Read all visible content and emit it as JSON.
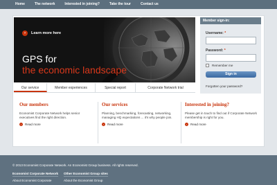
{
  "nav": {
    "items": [
      "Home",
      "The network",
      "Interested in joining?",
      "Take the tour",
      "Contact us"
    ]
  },
  "hero": {
    "learn_more": "Learn more here",
    "title_line1": "GPS for",
    "title_line2": "the economic landscape",
    "tabs": [
      "Our service",
      "Member experiences",
      "Special report",
      "Corporate Network trial"
    ]
  },
  "signin": {
    "header": "Member sign-in:",
    "username_label": "Username:",
    "password_label": "Password:",
    "required_mark": "*",
    "remember_label": "Remember me",
    "button_label": "Sign in",
    "forgot_link": "Forgotten your password?"
  },
  "columns": [
    {
      "title": "Our members",
      "body": "Economist Corporate Network helps senior executives find the right direction.",
      "read_more": "Read more"
    },
    {
      "title": "Our services",
      "body": "Planning, benchmarking, forecasting, networking, managing HQ expectations ... it's why people join.",
      "read_more": "Read more"
    },
    {
      "title": "Interested in joining?",
      "body": "Please get in touch to find out if Corporate Network membership is right for you.",
      "read_more": "Read more"
    }
  ],
  "footer": {
    "copyright": "© 2013 Economist Corporate Network. An Economist Group business. All rights reserved.",
    "col1_title": "Economist Corporate Network",
    "col1_link": "About Economist Corporate",
    "col2_title": "Other Economist Group sites",
    "col2_link": "About the Economist Group"
  },
  "colors": {
    "accent": "#c8340c",
    "nav_bg": "#5c6f7e",
    "hero_bg": "#121212",
    "signin_button": "#3a69a1"
  }
}
